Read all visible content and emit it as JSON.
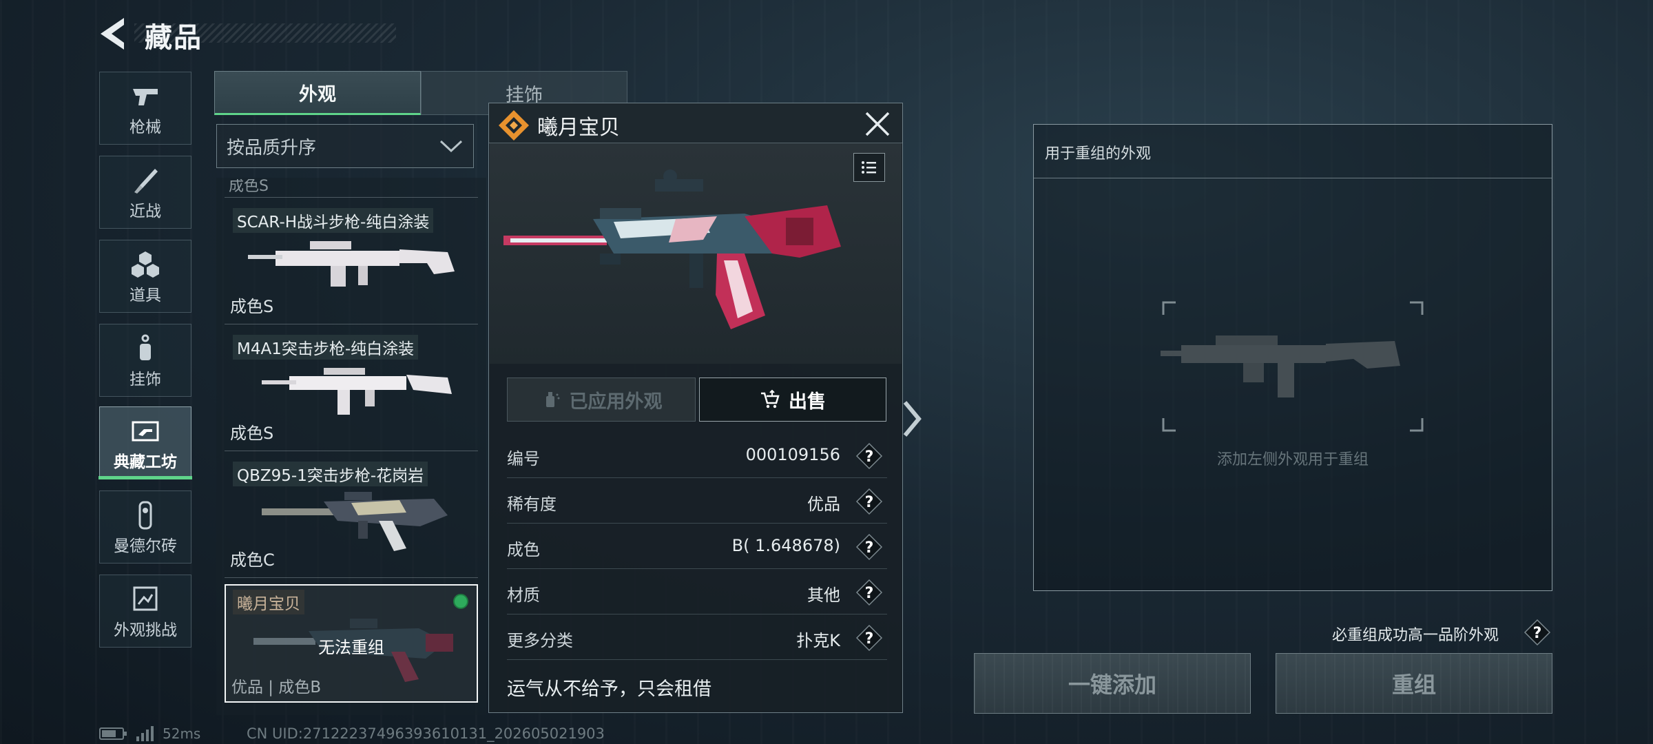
{
  "header": {
    "title": "藏品"
  },
  "categories": [
    {
      "label": "枪械",
      "icon": "pistol-icon"
    },
    {
      "label": "近战",
      "icon": "knife-icon"
    },
    {
      "label": "道具",
      "icon": "grenades-icon"
    },
    {
      "label": "挂饰",
      "icon": "charm-icon"
    },
    {
      "label": "典藏工坊",
      "icon": "workshop-icon",
      "active": true
    },
    {
      "label": "曼德尔砖",
      "icon": "brick-icon"
    },
    {
      "label": "外观挑战",
      "icon": "challenge-icon"
    }
  ],
  "tabs": [
    {
      "label": "外观",
      "active": true
    },
    {
      "label": "挂饰",
      "active": false
    }
  ],
  "sort": {
    "label": "按品质升序",
    "icon": "chevron-down-icon"
  },
  "list": {
    "cut_text": "成色S",
    "items": [
      {
        "name": "SCAR-H战斗步枪-纯白涂装",
        "grade": "成色S"
      },
      {
        "name": "M4A1突击步枪-纯白涂装",
        "grade": "成色S"
      },
      {
        "name": "QBZ95-1突击步枪-花岗岩",
        "grade": "成色C"
      }
    ],
    "selected": {
      "name": "曦月宝贝",
      "overlay": "无法重组",
      "grade": "优品 | 成色B"
    }
  },
  "detail": {
    "title": "曦月宝贝",
    "applied_label": "已应用外观",
    "sell_label": "出售",
    "attributes": [
      {
        "key": "编号",
        "value": "000109156"
      },
      {
        "key": "稀有度",
        "value": "优品"
      },
      {
        "key": "成色",
        "value": "B( 1.648678)"
      },
      {
        "key": "材质",
        "value": "其他"
      },
      {
        "key": "更多分类",
        "value": "扑克K"
      }
    ],
    "description": "运气从不给予，只会租借"
  },
  "recombine": {
    "header": "用于重组的外观",
    "hint": "添加左侧外观用于重组",
    "guarantee": "必重组成功高一品阶外观",
    "add_all_label": "一键添加",
    "recombine_label": "重组"
  },
  "status": {
    "ping": "52ms",
    "uid": "CN UID:27122237496393610131_202605021903"
  },
  "colors": {
    "accent": "#5fd48a",
    "selected_dot": "#2eaa5c",
    "brand": "#e8922e"
  }
}
